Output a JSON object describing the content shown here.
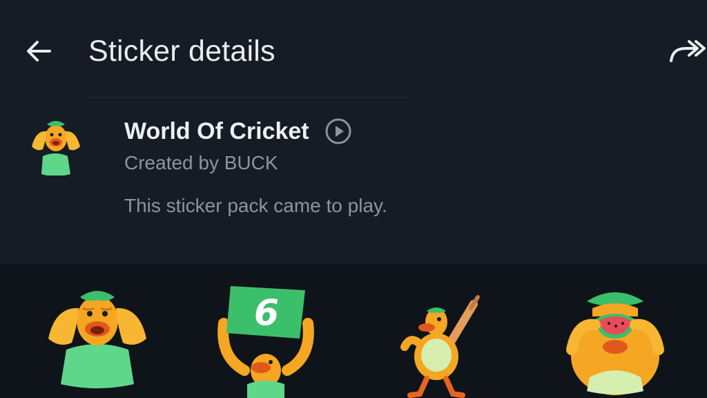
{
  "header": {
    "title": "Sticker details",
    "back_icon": "arrow-left-icon",
    "share_icon": "forward-share-icon"
  },
  "pack": {
    "name": "World Of Cricket",
    "creator": "Created by BUCK",
    "description": "This sticker pack came to play.",
    "play_icon": "play-circle-icon"
  },
  "stickers": [
    {
      "name": "duck-covering-face",
      "icon": "sticker-duck-shocked"
    },
    {
      "name": "duck-holding-six-sign",
      "icon": "sticker-duck-six",
      "sign_text": "6"
    },
    {
      "name": "duck-with-bat",
      "icon": "sticker-duck-bat"
    },
    {
      "name": "duck-eating-watermelon",
      "icon": "sticker-duck-watermelon"
    }
  ],
  "colors": {
    "background": "#141a22",
    "header_background": "#161c25",
    "grid_background": "#0f141b",
    "primary_text": "#e9edef",
    "secondary_text": "#8b959e",
    "sticker_green": "#5fd78a",
    "sticker_orange": "#f5a623"
  }
}
